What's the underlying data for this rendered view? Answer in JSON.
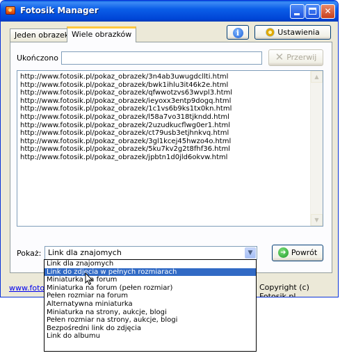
{
  "window": {
    "title": "Fotosik Manager"
  },
  "titlebar_buttons": {
    "minimize": "",
    "maximize": "",
    "close": "✕"
  },
  "tabs": [
    {
      "label": "Jeden obrazek",
      "active": false
    },
    {
      "label": "Wiele obrazków",
      "active": true
    }
  ],
  "toolbar": {
    "info_label": "i",
    "settings_label": "Ustawienia"
  },
  "status": {
    "label": "Ukończono",
    "value": ""
  },
  "interrupt_button": {
    "label": "Przerwij",
    "enabled": false
  },
  "links": [
    "http://www.fotosik.pl/pokaz_obrazek/3n4ab3uwugdcllti.html",
    "http://www.fotosik.pl/pokaz_obrazek/bwk1ihlu3it46k2e.html",
    "http://www.fotosik.pl/pokaz_obrazek/qfwwotzvs63wvpl3.html",
    "http://www.fotosik.pl/pokaz_obrazek/ieyoxx3entp9dogq.html",
    "http://www.fotosik.pl/pokaz_obrazek/1c1vs6b9ks1tx0kn.html",
    "http://www.fotosik.pl/pokaz_obrazek/l58a7vo318tjkndd.html",
    "http://www.fotosik.pl/pokaz_obrazek/2uzudkucflwg0er1.html",
    "http://www.fotosik.pl/pokaz_obrazek/ct79usb3etjhnkvq.html",
    "http://www.fotosik.pl/pokaz_obrazek/3gl1kcej45hwzo4o.html",
    "http://www.fotosik.pl/pokaz_obrazek/5ku7kv2g2t8fhf36.html",
    "http://www.fotosik.pl/pokaz_obrazek/jpbtn1d0jld6okvw.html"
  ],
  "show": {
    "label": "Pokaż:",
    "selected": "Link dla znajomych",
    "options": [
      "Link dla znajomych",
      "Link do zdjęcia w pełnych rozmiarach",
      "Miniaturka na forum",
      "Miniaturka na forum (pełen rozmiar)",
      "Pełen rozmiar na forum",
      "Alternatywna miniaturka",
      "Miniaturka na strony, aukcje, blogi",
      "Pełen rozmiar na strony, aukcje, blogi",
      "Bezpośredni link do zdjęcia",
      "Link do albumu"
    ],
    "highlighted_index": 1
  },
  "back_button": {
    "label": "Powrót"
  },
  "footer": {
    "link": "www.fotosik.pl",
    "copyright": "Copyright (c) Fotosik.pl"
  },
  "colors": {
    "title_bar": "#0054e3",
    "selection": "#316ac5",
    "link": "#0000ee"
  }
}
